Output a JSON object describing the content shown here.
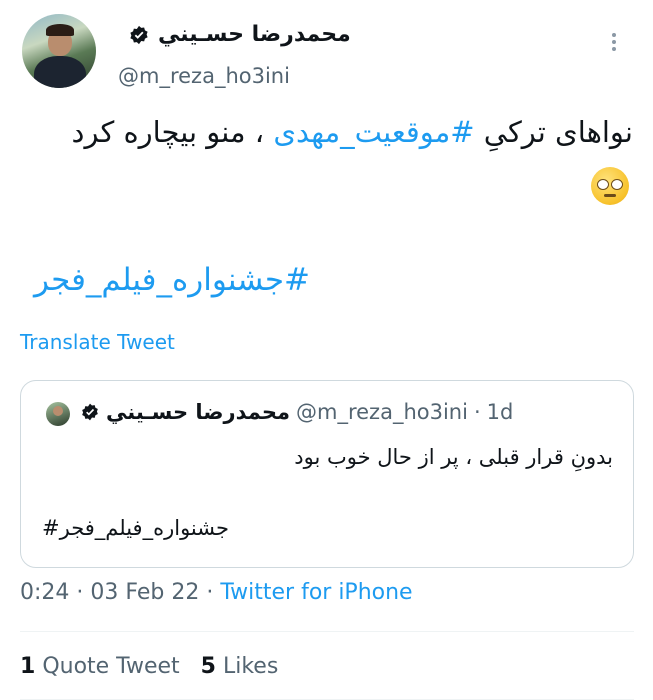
{
  "author": {
    "display_name": "محمدرضا حسـيني",
    "handle": "@m_reza_ho3ini",
    "verified_icon": "verified-badge-icon",
    "menu_icon": "more-options-icon"
  },
  "tweet": {
    "text_before": "نواهای ترکیِ ",
    "hashtag_inline": "#موقعیت_مهدی",
    "text_after": " ، منو بیچاره کرد",
    "emoji": "rolling-eyes-emoji",
    "hashtag_line": "#جشنواره_فیلم_فجر",
    "translate_label": "Translate Tweet"
  },
  "quoted_tweet": {
    "display_name": "محمدرضا حسـيني",
    "handle": "@m_reza_ho3ini",
    "separator": "·",
    "age": "1d",
    "text": "بدونِ قرار قبلی ، پر از حال خوب بود",
    "hashtag": "#جشنواره_فیلم_فجر"
  },
  "meta": {
    "time": "0:24",
    "sep1": "·",
    "date": "03 Feb 22",
    "sep2": "·",
    "source": "Twitter for iPhone"
  },
  "stats": {
    "quote_count": "1",
    "quote_label": "Quote Tweet",
    "likes_count": "5",
    "likes_label": "Likes"
  }
}
